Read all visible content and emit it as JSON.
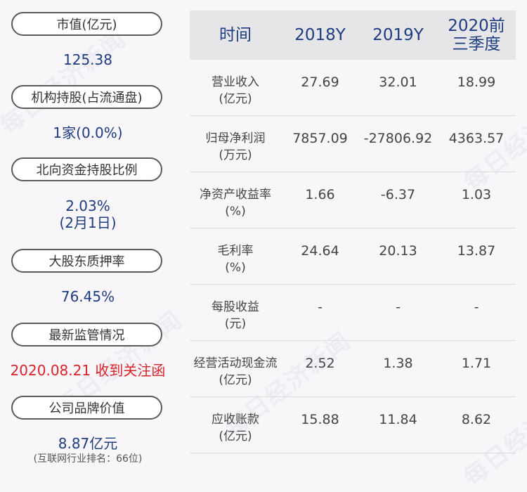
{
  "left": {
    "cards": [
      {
        "label": "市值(亿元)",
        "value": "125.38",
        "note": ""
      },
      {
        "label": "机构持股(占流通盘)",
        "value": "1家(0.0%)",
        "note": ""
      },
      {
        "label": "北向资金持股比例",
        "value": "2.03%",
        "value2": "(2月1日)",
        "note": ""
      },
      {
        "label": "大股东质押率",
        "value": "76.45%",
        "note": ""
      },
      {
        "label": "最新监管情况",
        "value": "2020.08.21 收到关注函",
        "note": ""
      },
      {
        "label": "公司品牌价值",
        "value": "8.87亿元",
        "note": "(互联网行业排名：66位)"
      }
    ]
  },
  "table": {
    "headers": [
      "时间",
      "2018Y",
      "2019Y",
      "2020前三季度"
    ],
    "rows": [
      {
        "label1": "营业收入",
        "label2": "(亿元)",
        "values": [
          "27.69",
          "32.01",
          "18.99"
        ]
      },
      {
        "label1": "归母净利润",
        "label2": "(万元)",
        "values": [
          "7857.09",
          "-27806.92",
          "4363.57"
        ]
      },
      {
        "label1": "净资产收益率",
        "label2": "(%)",
        "values": [
          "1.66",
          "-6.37",
          "1.03"
        ]
      },
      {
        "label1": "毛利率",
        "label2": "(%)",
        "values": [
          "24.64",
          "20.13",
          "13.87"
        ]
      },
      {
        "label1": "每股收益",
        "label2": "(元)",
        "values": [
          "-",
          "-",
          "-"
        ]
      },
      {
        "label1": "经营活动现金流",
        "label2": "(亿元)",
        "values": [
          "2.52",
          "1.38",
          "1.71"
        ]
      },
      {
        "label1": "应收账款",
        "label2": "(亿元)",
        "values": [
          "15.88",
          "11.84",
          "8.62"
        ]
      }
    ]
  },
  "watermark": "每日经济新闻",
  "colors": {
    "accent": "#1e3c80",
    "alert": "#d8232a",
    "header_bg": "#e6e5e8"
  }
}
